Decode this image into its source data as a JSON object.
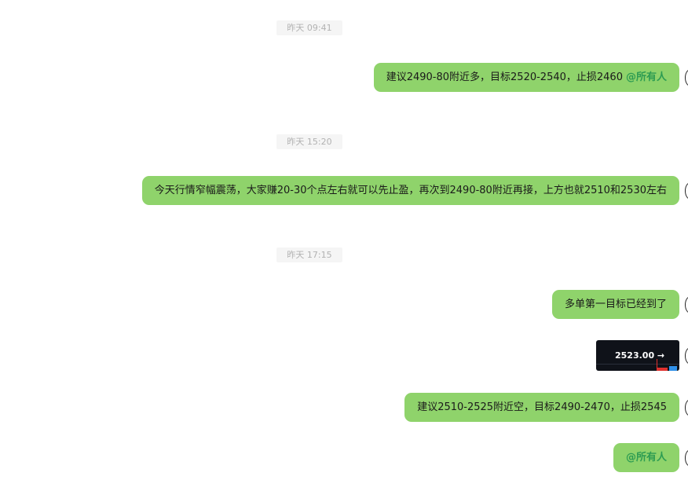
{
  "timestamps": [
    "昨天 09:41",
    "昨天 15:20",
    "昨天 17:15"
  ],
  "messages": {
    "msg1": {
      "text": "建议2490-80附近多，目标2520-2540，止损2460",
      "mention": "@所有人"
    },
    "msg2": {
      "text": "今天行情窄幅震荡，大家赚20-30个点左右就可以先止盈，再次到2490-80附近再接，上方也就2510和2530左右"
    },
    "msg3": {
      "text": "多单第一目标已经到了"
    },
    "image": {
      "price": "2523.00 →"
    },
    "msg4": {
      "text": "建议2510-2525附近空，目标2490-2470，止损2545"
    },
    "msg5": {
      "mention": "@所有人"
    }
  },
  "colors": {
    "bubble": "#8fd36b",
    "mention": "#2d9c52",
    "timestamp_bg": "#f5f5f5",
    "image_bg": "#0f1219"
  }
}
